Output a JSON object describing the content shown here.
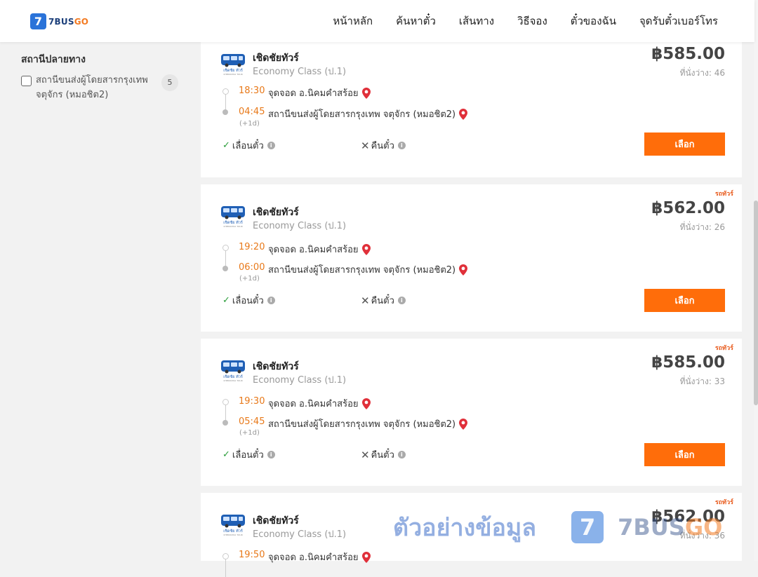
{
  "header": {
    "logo_number": "7",
    "logo_brand": "7BUS",
    "logo_brand_accent": "GO",
    "nav": [
      "หน้าหลัก",
      "ค้นหาตั๋ว",
      "เส้นทาง",
      "วิธีจอง",
      "ตั๋วของฉัน",
      "จุดรับตั๋วเบอร์โทร"
    ]
  },
  "sidebar": {
    "title": "สถานีปลายทาง",
    "filter": {
      "label": "สถานีขนส่งผู้โดยสารกรุงเทพ จตุจักร (หมอชิต2)",
      "count": "5"
    }
  },
  "trips": [
    {
      "tag": "",
      "operator": "เชิดชัยทัวร์",
      "class": "Economy Class (ป.1)",
      "price": "฿585.00",
      "seats": "ที่นั่งว่าง: 46",
      "dep_time": "18:30",
      "dep_stop": "จุดจอด อ.นิคมคำสร้อย",
      "arr_time": "04:45",
      "arr_stop": "สถานีขนส่งผู้โดยสารกรุงเทพ จตุจักร (หมอชิต2)",
      "plus_day": "(+1d)",
      "reschedule": "เลื่อนตั๋ว",
      "refund": "คืนตั๋ว",
      "select": "เลือก"
    },
    {
      "tag": "รถทัวร์",
      "operator": "เชิดชัยทัวร์",
      "class": "Economy Class (ป.1)",
      "price": "฿562.00",
      "seats": "ที่นั่งว่าง: 26",
      "dep_time": "19:20",
      "dep_stop": "จุดจอด อ.นิคมคำสร้อย",
      "arr_time": "06:00",
      "arr_stop": "สถานีขนส่งผู้โดยสารกรุงเทพ จตุจักร (หมอชิต2)",
      "plus_day": "(+1d)",
      "reschedule": "เลื่อนตั๋ว",
      "refund": "คืนตั๋ว",
      "select": "เลือก"
    },
    {
      "tag": "รถทัวร์",
      "operator": "เชิดชัยทัวร์",
      "class": "Economy Class (ป.1)",
      "price": "฿585.00",
      "seats": "ที่นั่งว่าง: 33",
      "dep_time": "19:30",
      "dep_stop": "จุดจอด อ.นิคมคำสร้อย",
      "arr_time": "05:45",
      "arr_stop": "สถานีขนส่งผู้โดยสารกรุงเทพ จตุจักร (หมอชิต2)",
      "plus_day": "(+1d)",
      "reschedule": "เลื่อนตั๋ว",
      "refund": "คืนตั๋ว",
      "select": "เลือก"
    },
    {
      "tag": "รถทัวร์",
      "operator": "เชิดชัยทัวร์",
      "class": "Economy Class (ป.1)",
      "price": "฿562.00",
      "seats": "ที่นั่งว่าง: 36",
      "dep_time": "19:50",
      "dep_stop": "จุดจอด อ.นิคมคำสร้อย",
      "arr_time": "",
      "arr_stop": "",
      "plus_day": "",
      "reschedule": "",
      "refund": "",
      "select": ""
    }
  ],
  "watermark": {
    "text": "ตัวอย่างข้อมูล",
    "badge": "7",
    "brand": "7BUS",
    "brand_accent": "GO"
  },
  "colors": {
    "accent": "#ff6d0a",
    "brand_blue": "#2a73d9",
    "time": "#e8791a",
    "pin": "#e0303a"
  }
}
